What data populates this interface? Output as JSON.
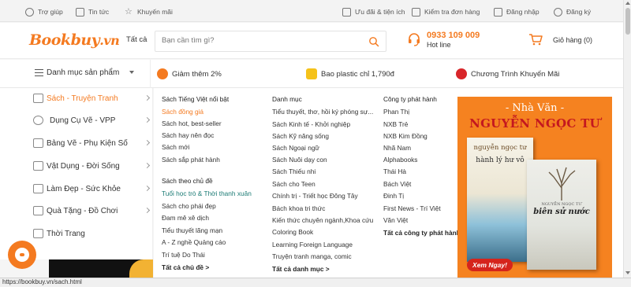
{
  "topbar": {
    "help": "Trợ giúp",
    "news": "Tin tức",
    "promo": "Khuyến mãi",
    "perks": "Ưu đãi & tiện ích",
    "order_check": "Kiểm tra đơn hàng",
    "login": "Đăng nhập",
    "register": "Đăng ký"
  },
  "header": {
    "logo_main": "Bookbuy",
    "logo_suffix": ".vn",
    "category_label": "Tất cả",
    "search_placeholder": "Bạn cần tìm gì?",
    "hotline_number": "0933 109 009",
    "hotline_label": "Hot line",
    "cart_label": "Giỏ hàng (0)"
  },
  "catbar": {
    "menu_label": "Danh mục sản phẩm",
    "promos": [
      "Giảm thêm 2%",
      "Bao plastic chỉ 1,790đ",
      "Chương Trình Khuyến Mãi"
    ]
  },
  "leftnav": {
    "items": [
      {
        "label": "Sách - Truyện Tranh",
        "icon": "book-icon"
      },
      {
        "label": "Dụng Cụ Vẽ - VPP",
        "icon": "palette-icon"
      },
      {
        "label": "Bảng Vẽ - Phụ Kiện Số",
        "icon": "tablet-icon"
      },
      {
        "label": "Vật Dụng - Đời Sống",
        "icon": "household-icon"
      },
      {
        "label": "Làm Đẹp - Sức Khỏe",
        "icon": "beauty-icon"
      },
      {
        "label": "Quà Tặng - Đồ Chơi",
        "icon": "gift-icon"
      },
      {
        "label": "Thời Trang",
        "icon": "shirt-icon"
      }
    ]
  },
  "mega": {
    "col1": {
      "heading1": "Sách Tiếng Việt nổi bật",
      "links1": [
        "Sách đồng giá",
        "Sách hot, best-seller",
        "Sách hay nên đọc",
        "Sách mới",
        "Sách sắp phát hành"
      ],
      "heading2": "Sách theo chủ đề",
      "links2": [
        "Tuổi học trò & Thời thanh xuân",
        "Sách cho phái đẹp",
        "Đam mê xê dịch",
        "Tiểu thuyết lãng mạn",
        "A - Z nghề Quảng cáo",
        "Trí tuệ Do Thái"
      ],
      "more": "Tất cả chủ đề >"
    },
    "col2": {
      "heading": "Danh mục",
      "links": [
        "Tiểu thuyết, thơ, hồi ký phóng sự...",
        "Sách Kinh tế - Khởi nghiệp",
        "Sách Kỹ năng sống",
        "Sách Ngoại ngữ",
        "Sách Nuôi dạy con",
        "Sách Thiếu nhi",
        "Sách cho Teen",
        "Chính trị - Triết học Đông Tây",
        "Bách khoa tri thức",
        "Kiến thức chuyên ngành,Khoa cứu",
        "Coloring Book",
        "Learning Foreign Language",
        "Truyện tranh manga, comic"
      ],
      "more": "Tất cả danh mục >"
    },
    "col3": {
      "heading": "Công ty phát hành",
      "links": [
        "Phan Thị",
        "NXB Trẻ",
        "NXB Kim Đồng",
        "Nhã Nam",
        "Alphabooks",
        "Thái Hà",
        "Bách Việt",
        "Đinh Tị",
        "First News - Trí Việt",
        "Văn Việt"
      ],
      "more": "Tất cả công ty phát hành >"
    }
  },
  "banner": {
    "pre_title": "- Nhà Văn -",
    "author": "NGUYỄN NGỌC TƯ",
    "book1_author": "nguyễn ngọc tư",
    "book1_title": "hành lý hư vô",
    "book2_author": "NGUYỄN NGỌC TƯ",
    "book2_title": "biên sử nước",
    "cta": "Xem Ngay!"
  },
  "status": {
    "url": "https://bookbuy.vn/sach.html"
  },
  "colors": {
    "brand": "#f47a20",
    "banner_bg": "#f58220",
    "banner_title": "#c4181f"
  }
}
